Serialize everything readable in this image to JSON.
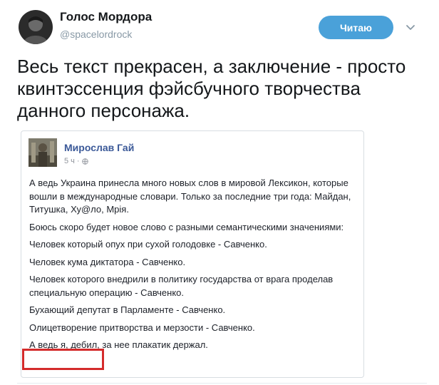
{
  "tweet": {
    "author_name": "Голос Мордора",
    "handle": "@spacelordrock",
    "follow_label": "Читаю",
    "text": "Весь текст прекрасен, а заключение - просто квинтэссенция фэйсбучного творчества данного персонажа."
  },
  "fb_post": {
    "author": "Мирослав Гай",
    "time": "5 ч",
    "paragraphs": [
      "А ведь Украина принесла много новых слов в мировой Лексикон, которые вошли в международные словари. Только за последние три года: Майдан, Титушка, Ху@ло, Мрія.",
      "Боюсь скоро будет новое слово с разными семантическими значениями:",
      "Человек который опух при сухой голодовке - Савченко.",
      "Человек кума диктатора - Савченко.",
      "Человек которого внедрили в политику государства от врага проделав специальную операцию - Савченко.",
      "Бухающий депутат в Парламенте - Савченко.",
      "Олицетворение притворства и мерзости - Савченко.",
      "А ведь я, дебил, за нее плакатик держал."
    ]
  },
  "colors": {
    "follow_button": "#4aa1d9",
    "fb_name": "#3b5998",
    "highlight_box": "#d42b2b"
  },
  "icons": {
    "chevron": "chevron-down-icon",
    "globe": "globe-icon"
  }
}
